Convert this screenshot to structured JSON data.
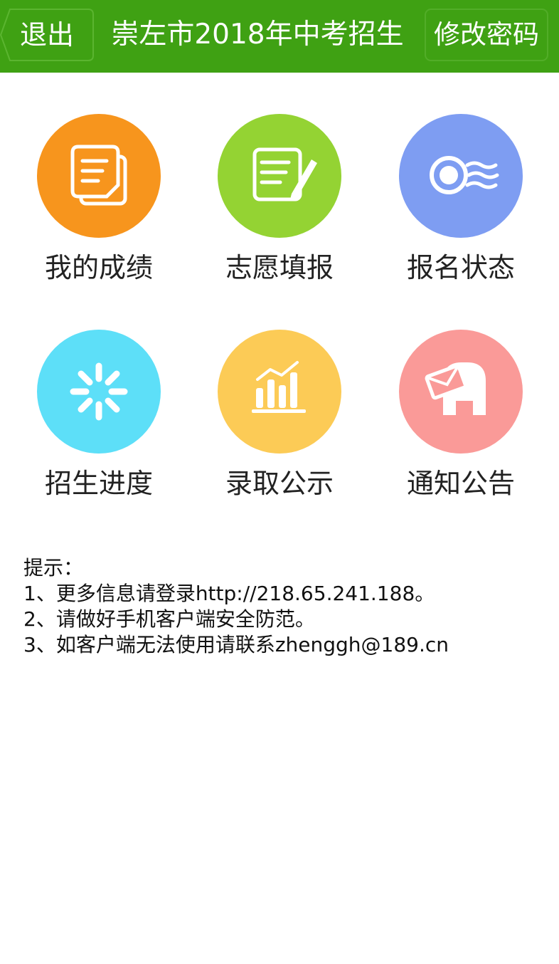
{
  "header": {
    "back_label": "退出",
    "title": "崇左市2018年中考招生",
    "change_password_label": "修改密码",
    "background_color": "#3fa113"
  },
  "menu": [
    {
      "label": "我的成绩",
      "icon": "score-document-icon",
      "color": "#f7951d"
    },
    {
      "label": "志愿填报",
      "icon": "edit-form-icon",
      "color": "#94d333"
    },
    {
      "label": "报名状态",
      "icon": "postmark-icon",
      "color": "#7e9df2"
    },
    {
      "label": "招生进度",
      "icon": "loading-spinner-icon",
      "color": "#5ddff8"
    },
    {
      "label": "录取公示",
      "icon": "bar-chart-icon",
      "color": "#fccb56"
    },
    {
      "label": "通知公告",
      "icon": "mailbox-icon",
      "color": "#fa9a98"
    }
  ],
  "tips": {
    "heading": "提示：",
    "lines": [
      "1、更多信息请登录http://218.65.241.188。",
      "2、请做好手机客户端安全防范。",
      "3、如客户端无法使用请联系zhenggh@189.cn"
    ]
  }
}
